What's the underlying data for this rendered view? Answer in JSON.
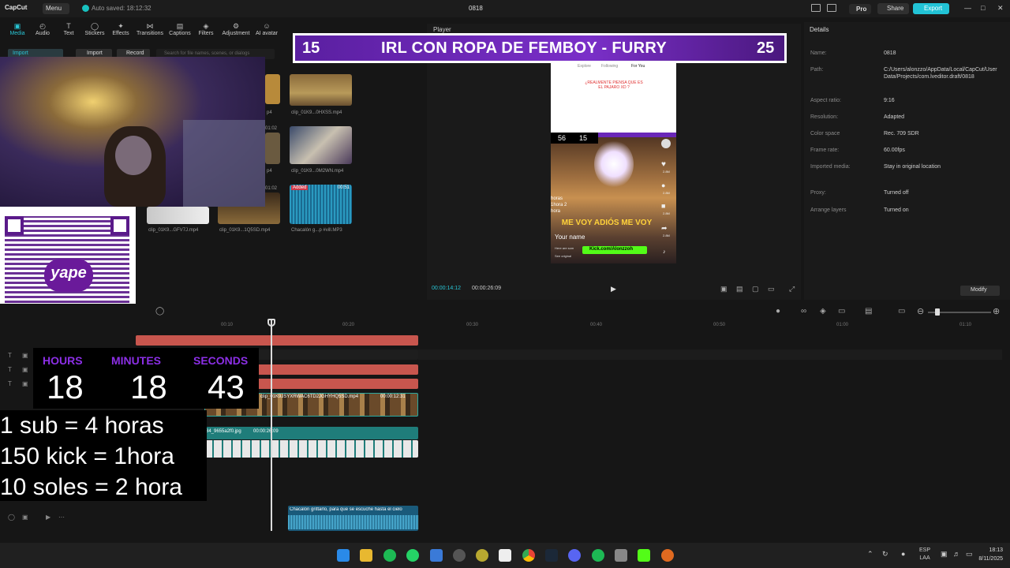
{
  "titlebar": {
    "logo": "CapCut",
    "menu": "Menu",
    "auto_saved": "Auto saved: 18:12:32",
    "project_name": "0818",
    "pro": "Pro",
    "share": "Share",
    "export": "Export"
  },
  "toolbar": {
    "items": [
      {
        "label": "Media",
        "icon": "media-icon"
      },
      {
        "label": "Audio",
        "icon": "audio-icon"
      },
      {
        "label": "Text",
        "icon": "text-icon"
      },
      {
        "label": "Stickers",
        "icon": "stickers-icon"
      },
      {
        "label": "Effects",
        "icon": "effects-icon"
      },
      {
        "label": "Transitions",
        "icon": "transitions-icon"
      },
      {
        "label": "Captions",
        "icon": "captions-icon"
      },
      {
        "label": "Filters",
        "icon": "filters-icon"
      },
      {
        "label": "Adjustment",
        "icon": "adjustment-icon"
      },
      {
        "label": "AI avatar",
        "icon": "ai-avatar-icon"
      }
    ]
  },
  "media": {
    "left_tab": "Import",
    "import_button": "Import",
    "record_button": "Record",
    "search_placeholder": "Search for file names, scenes, or dialogs",
    "items": [
      {
        "label": "p4"
      },
      {
        "label": "clip_01K9...0HXSS.mp4"
      },
      {
        "label": "01:02"
      },
      {
        "label": "p4"
      },
      {
        "label": "clip_01K9...0M2WN.mp4"
      },
      {
        "label": "01:02"
      },
      {
        "label": "clip_01K9...GFV7J.mp4"
      },
      {
        "label": "clip_01K9...1Q5SD.mp4"
      },
      {
        "label": "Chacalón g...p #vill.MP3"
      },
      {
        "label": "Added"
      },
      {
        "label": "00:51"
      }
    ]
  },
  "player": {
    "title": "Player",
    "time_current": "00:00:14:12",
    "time_total": "00:00:26:09",
    "tiktok_tabs": [
      "Explore",
      "Following",
      "For You"
    ],
    "tiktok_caption": "¿REALMENTE PIENSA QUE ES EL PAJARO XD ?",
    "tiktok_overlay_left": "56",
    "tiktok_overlay_right": "15",
    "side_counts": [
      "2.8M",
      "2.8M",
      "2.8M",
      "2.8M"
    ],
    "side_left_text": "horas 1hora 2 hora",
    "big_text": "ME VOY ADIÓS ME VOY",
    "your_name": "Your name",
    "kick": "Kick.com/Alonzzoh",
    "small_lines": [
      "Here are som",
      "See original"
    ]
  },
  "banner": {
    "left_num": "15",
    "text": "IRL CON ROPA DE FEMBOY - FURRY",
    "right_num": "25"
  },
  "details": {
    "title": "Details",
    "rows": [
      {
        "key": "Name:",
        "value": "0818"
      },
      {
        "key": "Path:",
        "value": "C:/Users/alonzzo/AppData/Local/CapCut/User Data/Projects/com.lveditor.draft/0818"
      },
      {
        "key": "Aspect ratio:",
        "value": "9:16"
      },
      {
        "key": "Resolution:",
        "value": "Adapted"
      },
      {
        "key": "Color space",
        "value": "Rec. 709 SDR"
      },
      {
        "key": "Frame rate:",
        "value": "60.00fps"
      },
      {
        "key": "Imported media:",
        "value": "Stay in original location"
      },
      {
        "key": "Proxy:",
        "value": "Turned off"
      },
      {
        "key": "Arrange layers",
        "value": "Turned on"
      }
    ],
    "modify": "Modify"
  },
  "timeline": {
    "ticks": [
      "00:10",
      "00:20",
      "00:30",
      "00:40",
      "00:50",
      "01:00",
      "01:10"
    ],
    "video_clip_label": "clip_01K9JSYXRWAC6TD2JGHYHQ5SD.mp4",
    "video_clip_time": "00:00:12:31",
    "image_clip_label": "84_9655a2f0.jpg",
    "image_clip_time": "00:00:26:09",
    "audio_clip_label": "Chacalón grittarlo, para que se escuche hasta el cielo"
  },
  "counter": {
    "hours_label": "HOURS",
    "minutes_label": "MINUTES",
    "seconds_label": "SECONDS",
    "hours": "18",
    "minutes": "18",
    "seconds": "43"
  },
  "rules": [
    "1 sub = 4 horas",
    "150 kick = 1hora",
    "10 soles = 2 hora"
  ],
  "qr": {
    "brand": "yape"
  },
  "taskbar": {
    "lang_top": "ESP",
    "lang_bottom": "LAA",
    "time": "18:13",
    "date": "8/11/2025"
  },
  "colors": {
    "accent": "#29c6d6",
    "banner_purple": "#6b27b8",
    "counter_purple": "#8c2fe6",
    "clip_red": "#c8564e",
    "clip_teal": "#1f7d7a"
  }
}
